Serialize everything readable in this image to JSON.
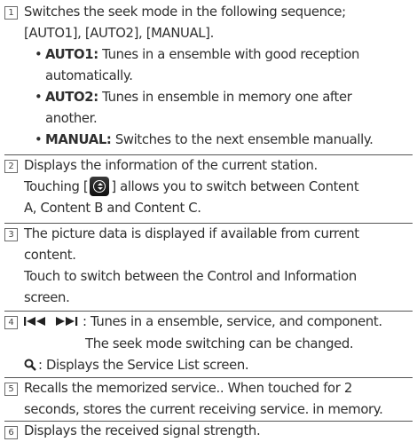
{
  "items": [
    {
      "number": "1",
      "intro": [
        "Switches the seek mode in the following sequence;",
        "[AUTO1], [AUTO2], [MANUAL]."
      ],
      "bullets": [
        {
          "term": "AUTO1:",
          "text": " Tunes in a ensemble with good reception",
          "cont": "automatically."
        },
        {
          "term": "AUTO2:",
          "text": " Tunes in ensemble in memory one after",
          "cont": "another."
        },
        {
          "term": "MANUAL:",
          "text": " Switches to the next ensemble manually."
        }
      ]
    },
    {
      "number": "2",
      "line1": "Displays the information of the current station.",
      "line2_before": "Touching [",
      "line2_after": "] allows you to switch between Content",
      "line3": "A, Content B and Content C."
    },
    {
      "number": "3",
      "lines": [
        "The picture data is displayed if available from current",
        "content.",
        "Touch to switch between the Control and Information",
        "screen."
      ]
    },
    {
      "number": "4",
      "seek_text": ": Tunes in a ensemble, service, and component.",
      "seek_note": "The seek mode switching can be changed.",
      "search_text": ": Displays the Service List screen."
    },
    {
      "number": "5",
      "lines": [
        "Recalls the memorized service.. When touched for 2",
        "seconds, stores the current receiving service. in memory."
      ]
    },
    {
      "number": "6",
      "line": "Displays the received signal strength."
    }
  ],
  "icons": [
    "content-switch-icon",
    "seek-backward-icon",
    "seek-forward-icon",
    "search-icon"
  ]
}
